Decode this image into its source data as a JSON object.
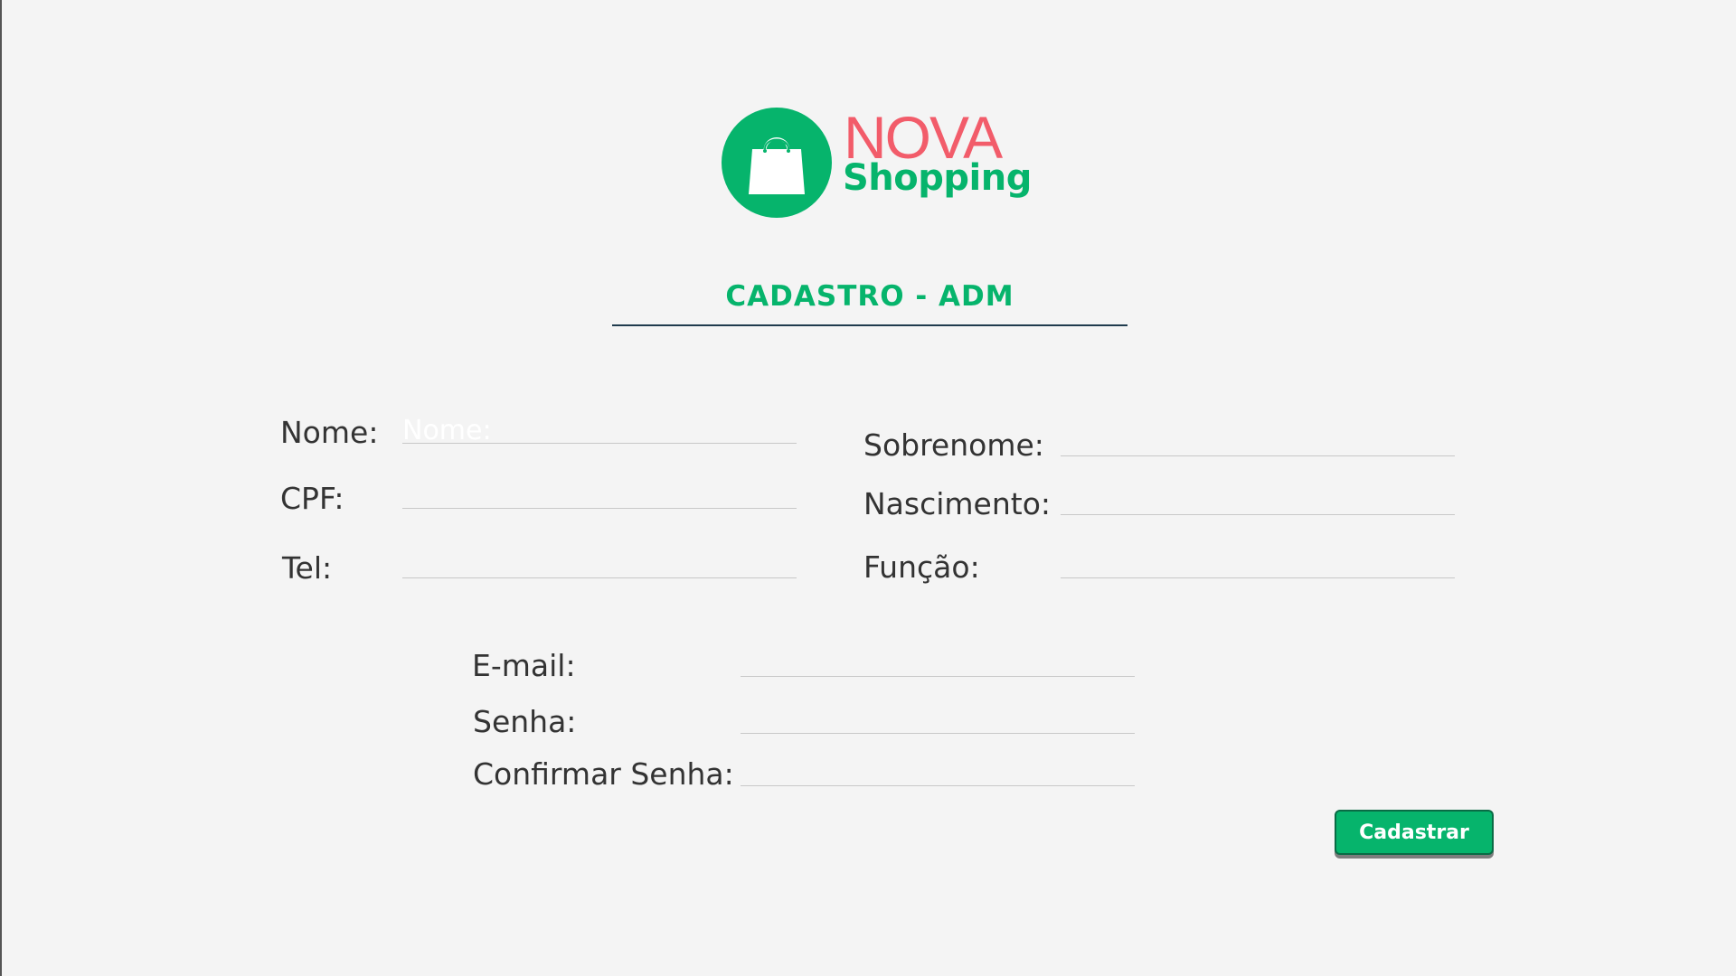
{
  "logo": {
    "icon": "shopping-bag-icon",
    "brand_top": "NOVA",
    "brand_bottom": "Shopping",
    "colors": {
      "green": "#06b46c",
      "red": "#f25c6a"
    }
  },
  "form": {
    "title": "CADASTRO - ADM",
    "fields": {
      "nome": {
        "label": "Nome:",
        "placeholder": "Nome:",
        "value": ""
      },
      "sobrenome": {
        "label": "Sobrenome:",
        "value": ""
      },
      "cpf": {
        "label": "CPF:",
        "value": ""
      },
      "nascimento": {
        "label": "Nascimento:",
        "value": ""
      },
      "tel": {
        "label": "Tel:",
        "value": ""
      },
      "funcao": {
        "label": "Função:",
        "value": ""
      },
      "email": {
        "label": "E-mail:",
        "value": ""
      },
      "senha": {
        "label": "Senha:",
        "value": ""
      },
      "confirmar_senha": {
        "label": "Confirmar Senha:",
        "value": ""
      }
    },
    "submit_label": "Cadastrar"
  },
  "colors": {
    "background": "#f4f4f4",
    "accent": "#06b46c",
    "title_underline": "#1f3b4d"
  }
}
